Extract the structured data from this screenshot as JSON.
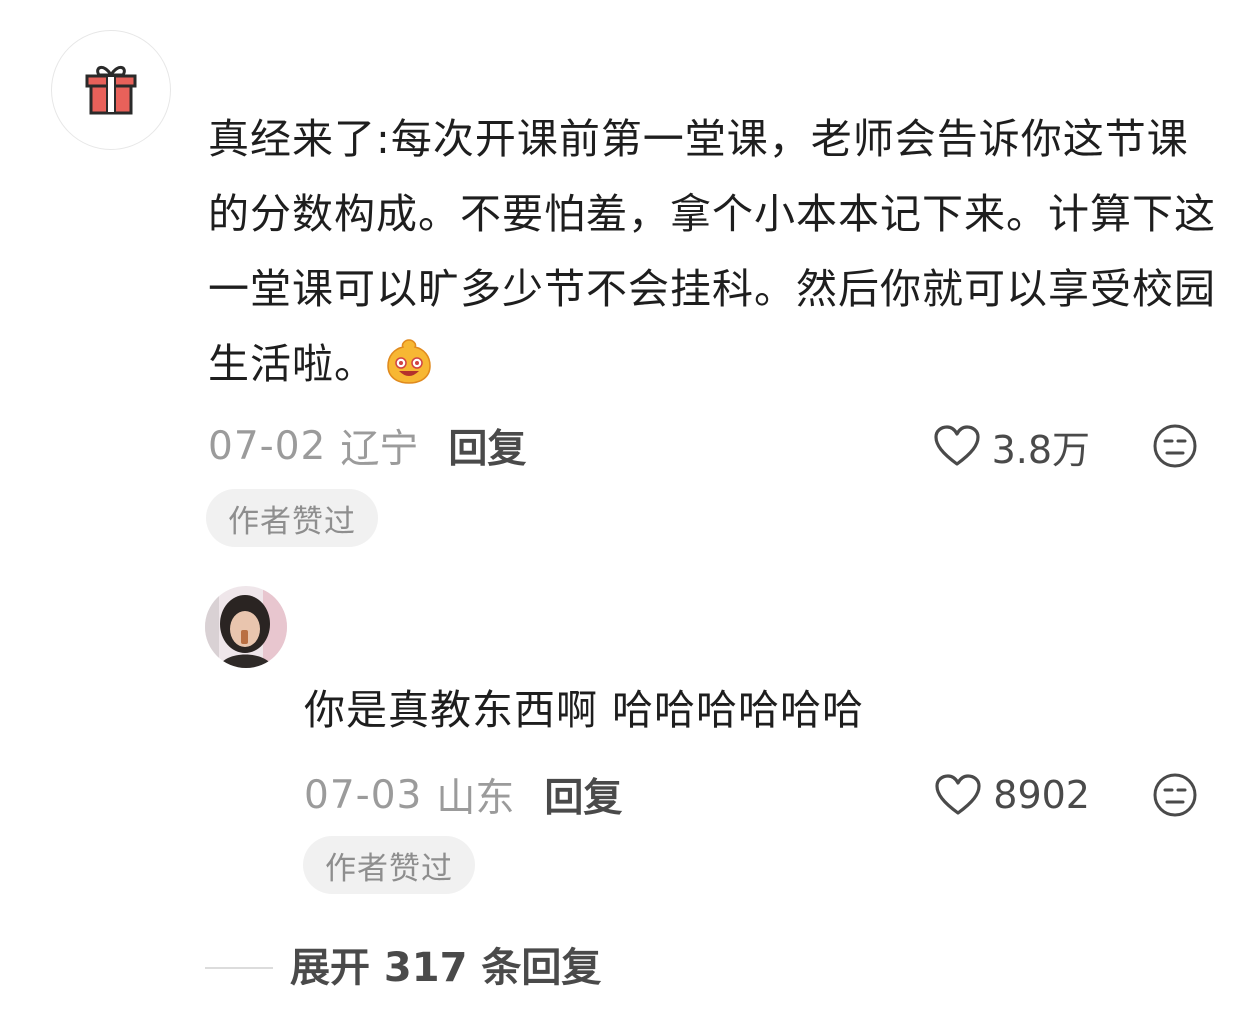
{
  "comment": {
    "avatar_icon": "gift-icon",
    "username": "",
    "text": "真经来了:每次开课前第一堂课，老师会告诉你这节课的分数构成。不要怕羞，拿个小本本记下来。计算下这一堂课可以旷多少节不会挂科。然后你就可以享受校园生活啦。",
    "emoji": "smiling-face-emoji",
    "date": "07-02",
    "location": "辽宁",
    "reply_label": "回复",
    "likes": "3.8万",
    "badge": "作者赞过"
  },
  "reply": {
    "text": "你是真教东西啊 哈哈哈哈哈哈",
    "date": "07-03",
    "location": "山东",
    "reply_label": "回复",
    "likes": "8902",
    "badge": "作者赞过"
  },
  "expand": {
    "label": "展开 317 条回复"
  },
  "colors": {
    "gift_red": "#e8615a",
    "text": "#1e1e1e",
    "meta": "#9b9b9b",
    "badge_bg": "#f1f1f1"
  }
}
